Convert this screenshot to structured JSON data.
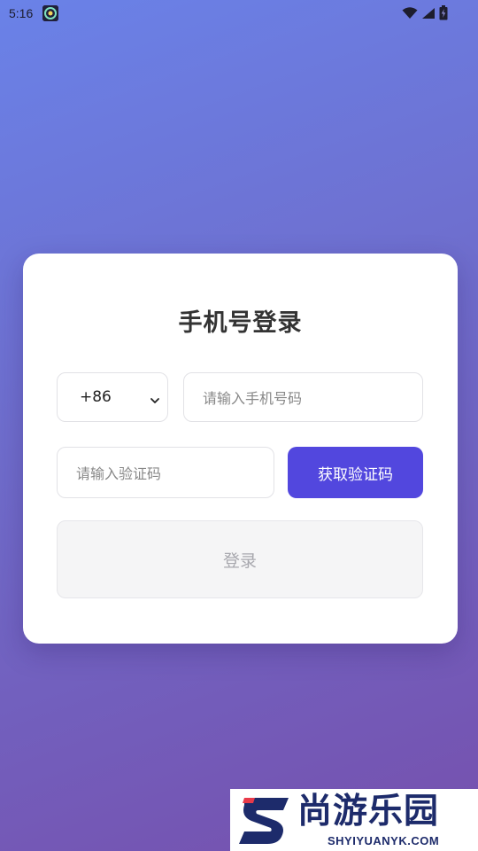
{
  "status_bar": {
    "time": "5:16",
    "app_icon": "notification-app-icon",
    "wifi_icon": "wifi-icon",
    "signal_icon": "cell-signal-icon",
    "battery_icon": "battery-charging-icon"
  },
  "login": {
    "title": "手机号登录",
    "country_code": "+86",
    "phone_placeholder": "请输入手机号码",
    "code_placeholder": "请输入验证码",
    "get_code_label": "获取验证码",
    "submit_label": "登录"
  },
  "watermark": {
    "name": "尚游乐园",
    "domain": "SHYIYUANYK.COM"
  },
  "colors": {
    "accent": "#5247de",
    "background_top": "#6a82e8",
    "background_bottom": "#7650ad",
    "card": "#ffffff",
    "disabled_button": "#f5f5f6"
  }
}
